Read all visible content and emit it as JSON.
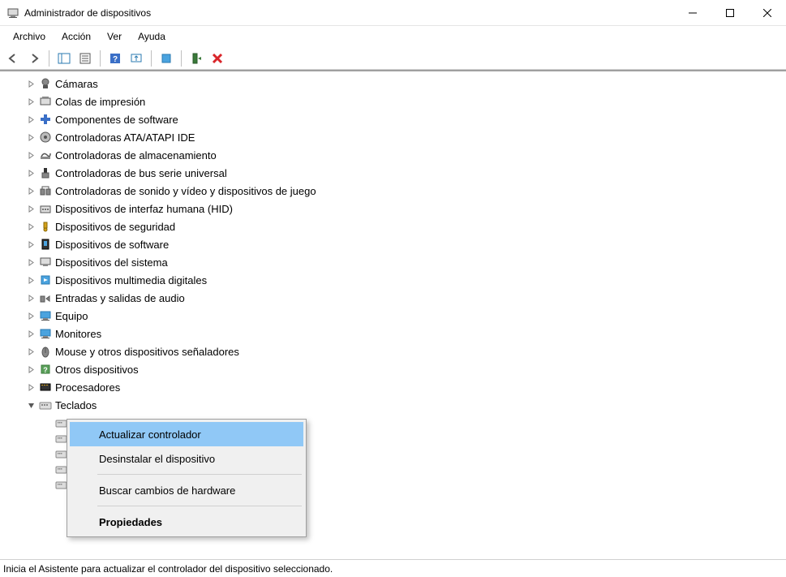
{
  "window": {
    "title": "Administrador de dispositivos"
  },
  "menu": {
    "items": [
      "Archivo",
      "Acción",
      "Ver",
      "Ayuda"
    ]
  },
  "tree": {
    "items": [
      {
        "label": "Cámaras",
        "expanded": false
      },
      {
        "label": "Colas de impresión",
        "expanded": false
      },
      {
        "label": "Componentes de software",
        "expanded": false
      },
      {
        "label": "Controladoras ATA/ATAPI IDE",
        "expanded": false
      },
      {
        "label": "Controladoras de almacenamiento",
        "expanded": false
      },
      {
        "label": "Controladoras de bus serie universal",
        "expanded": false
      },
      {
        "label": "Controladoras de sonido y vídeo y dispositivos de juego",
        "expanded": false
      },
      {
        "label": "Dispositivos de interfaz humana (HID)",
        "expanded": false
      },
      {
        "label": "Dispositivos de seguridad",
        "expanded": false
      },
      {
        "label": "Dispositivos de software",
        "expanded": false
      },
      {
        "label": "Dispositivos del sistema",
        "expanded": false
      },
      {
        "label": "Dispositivos multimedia digitales",
        "expanded": false
      },
      {
        "label": "Entradas y salidas de audio",
        "expanded": false
      },
      {
        "label": "Equipo",
        "expanded": false
      },
      {
        "label": "Monitores",
        "expanded": false
      },
      {
        "label": "Mouse y otros dispositivos señaladores",
        "expanded": false
      },
      {
        "label": "Otros dispositivos",
        "expanded": false
      },
      {
        "label": "Procesadores",
        "expanded": false
      },
      {
        "label": "Teclados",
        "expanded": true
      }
    ]
  },
  "context_menu": {
    "items": [
      {
        "label": "Actualizar controlador",
        "highlighted": true
      },
      {
        "label": "Desinstalar el dispositivo",
        "highlighted": false
      },
      {
        "label": "Buscar cambios de hardware",
        "highlighted": false
      },
      {
        "label": "Propiedades",
        "highlighted": false,
        "bold": true
      }
    ]
  },
  "statusbar": {
    "text": "Inicia el Asistente para actualizar el controlador del dispositivo seleccionado."
  }
}
